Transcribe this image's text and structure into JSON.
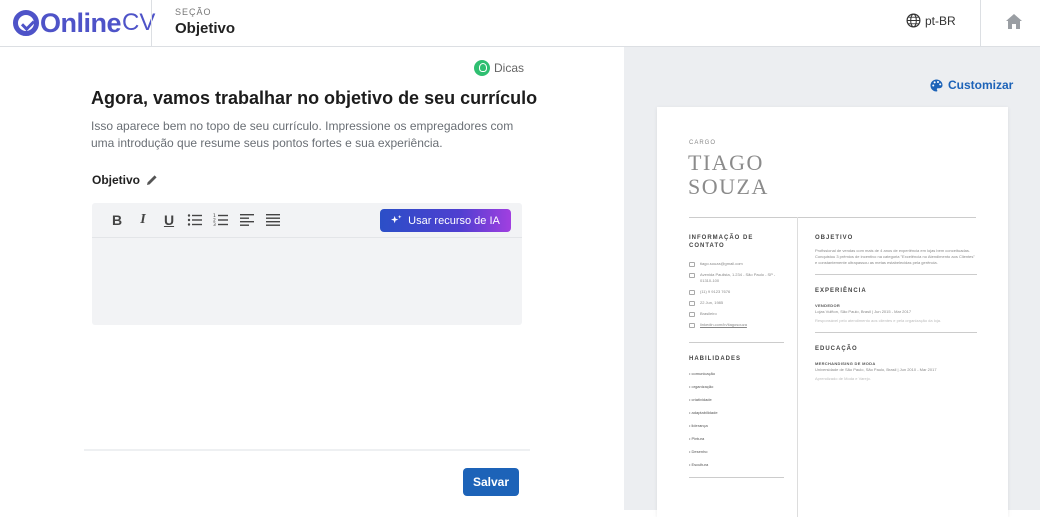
{
  "header": {
    "logo_main": "Online",
    "logo_suffix": "CV",
    "section_caption": "SEÇÃO",
    "section_name": "Objetivo",
    "language": "pt-BR",
    "home_icon": "home-icon"
  },
  "editor": {
    "tips_label": "Dicas",
    "heading": "Agora, vamos trabalhar no objetivo de seu currículo",
    "description": "Isso aparece bem no topo de seu currículo. Impressione os empregadores com uma introdução que resume seus pontos fortes e sua experiência.",
    "field_label": "Objetivo",
    "toolbar": {
      "bold": "B",
      "italic": "I",
      "underline": "U",
      "ai_button": "Usar recurso de IA"
    },
    "content": "",
    "save_label": "Salvar"
  },
  "preview": {
    "customize_label": "Customizar",
    "resume": {
      "cargo": "CARGO",
      "first_name": "TIAGO",
      "last_name": "SOUZA",
      "contact_heading": "INFORMAÇÃO DE CONTATO",
      "contacts": [
        "tiago.souza@gmail.com",
        "Avenida Paulista, 1.234 - São Paulo - SP - 01310-100",
        "(11) 9 9123 7676",
        "22 Jun, 1985",
        "Brasileiro",
        "linkedin.com/in/tiagosouza"
      ],
      "skills_heading": "HABILIDADES",
      "skills": [
        "comunicação",
        "organização",
        "criatividade",
        "adaptabilidade",
        "liderança",
        "Pintura",
        "Desenho",
        "Escultura"
      ],
      "objective_heading": "OBJETIVO",
      "objective_text": "Profissional de vendas com mais de 4 anos de experiência em lojas bem conceituadas. Conquistou 3 prêmios de incentivo na categoria \"Excelência no Atendimento aos Clientes\" e constantemente ultrapassou as metas estabelecidas pela gerência.",
      "experience_heading": "EXPERIÊNCIA",
      "experience_title": "VENDEDOR",
      "experience_sub": "Lojas Vulfton, São Paulo, Brasil | Jun 2015 - Mar 2017",
      "experience_fade": "Responsável pelo atendimento aos clientes e pela organização da loja.",
      "education_heading": "EDUCAÇÃO",
      "education_title": "MERCHANDISING DE MODA",
      "education_sub": "Universidade de São Paulo, São Paulo, Brasil | Jun 2010 - Mar 2017",
      "education_fade": "Aprendizado de Moda e Varejo."
    }
  }
}
